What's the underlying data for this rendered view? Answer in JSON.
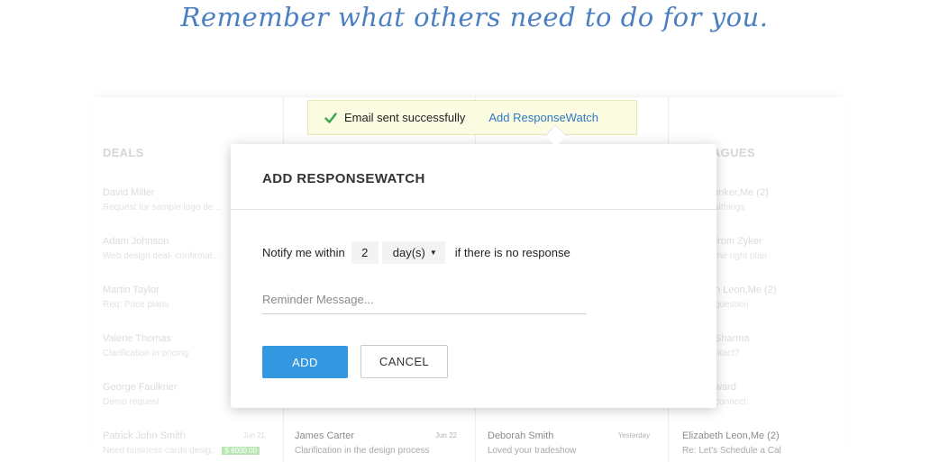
{
  "tagline": "Remember what others need to do for you.",
  "toast": {
    "message": "Email sent successfully",
    "link": "Add ResponseWatch",
    "accent_color": "#2f79c4",
    "check_color": "#3aa64a"
  },
  "board": {
    "col1": {
      "title": "DEALS",
      "cards": [
        {
          "name": "David Miller",
          "subject": "Request for sample logo de..."
        },
        {
          "name": "Adam Johnson",
          "subject": "Web design deal- confirmat..."
        },
        {
          "name": "Martin Taylor",
          "subject": "Req: Price plans"
        },
        {
          "name": "Valerie Thomas",
          "subject": "Clarification in pricing"
        },
        {
          "name": "George Faulkner",
          "subject": "Demo request"
        },
        {
          "name": "Patrick John Smith",
          "subject": "Need business cards desig...",
          "date": "Jun 21",
          "tag": "$ 6000.00"
        }
      ]
    },
    "col2": {
      "cards": [
        {
          "name": "James Carter",
          "subject": "Clarification in the design process",
          "date": "Jun 22"
        }
      ]
    },
    "col3": {
      "cards": [
        {
          "name": "Deborah Smith",
          "subject": "Loved your tradeshow",
          "date": "Yesterday"
        }
      ]
    },
    "col4": {
      "title": "EAGUES",
      "cards": [
        {
          "name": "onker,Me (2)",
          "subject": "Althings"
        },
        {
          "name": "from Zyker",
          "subject": "the right plan"
        },
        {
          "name": "n Leon,Me (2)",
          "subject": "question"
        },
        {
          "name": "Sharma",
          "subject": "ntact?"
        },
        {
          "name": "ward",
          "subject": "connect"
        },
        {
          "name": "Elizabeth Leon,Me (2)",
          "subject": "Re: Let's Schedule a Cal"
        }
      ]
    }
  },
  "modal": {
    "title": "ADD RESPONSEWATCH",
    "notify_label": "Notify me within",
    "notify_value": "2",
    "unit": "day(s)",
    "after_label": "if there is no response",
    "reminder_placeholder": "Reminder Message...",
    "add_label": "ADD",
    "cancel_label": "CANCEL",
    "primary_color": "#3398e0"
  }
}
